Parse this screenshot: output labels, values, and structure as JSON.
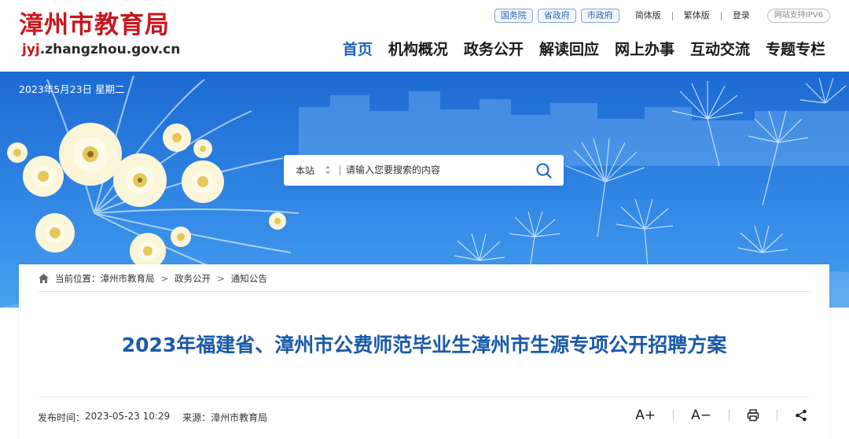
{
  "site": {
    "title": "漳州市教育局",
    "domain_prefix": "jyj",
    "domain_rest": ".zhangzhou.gov.cn"
  },
  "top_links": {
    "gov": [
      "国务院",
      "省政府",
      "市政府"
    ],
    "simplified": "简体版",
    "traditional": "繁体版",
    "login": "登录",
    "ipv6": "网站支持IPV6"
  },
  "nav": {
    "items": [
      "首页",
      "机构概况",
      "政务公开",
      "解读回应",
      "网上办事",
      "互动交流",
      "专题专栏"
    ],
    "active_index": 0
  },
  "banner": {
    "date": "2023年5月23日 星期二"
  },
  "search": {
    "scope": "本站",
    "placeholder": "请输入您要搜索的内容"
  },
  "breadcrumb": {
    "prefix": "当前位置：",
    "items": [
      "漳州市教育局",
      "政务公开",
      "通知公告"
    ],
    "separator": ">"
  },
  "article": {
    "title": "2023年福建省、漳州市公费师范毕业生漳州市生源专项公开招聘方案",
    "publish_label": "发布时间：",
    "publish_time": "2023-05-23 10:29",
    "source_label": "来源：",
    "source": "漳州市教育局"
  },
  "tools": {
    "font_larger": "A+",
    "font_smaller": "A−"
  },
  "colors": {
    "brand_red": "#c8161d",
    "nav_active": "#1a63b8",
    "title_blue": "#1a5aa8",
    "banner_blue": "#2b7fe0"
  }
}
